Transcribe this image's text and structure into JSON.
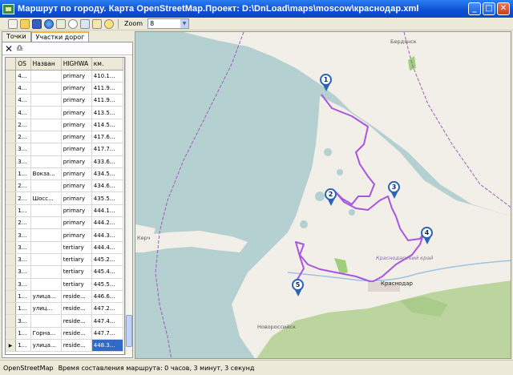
{
  "window": {
    "title": "Маршрут по городу. Карта OpenStreetMap.Проект: D:\\DnLoad\\maps\\moscow\\краснодар.xml",
    "minimize": "_",
    "maximize": "□",
    "close": "✕"
  },
  "toolbar": {
    "zoom_label": "Zoom",
    "zoom_value": "8",
    "icons": [
      "new-file-icon",
      "open-folder-icon",
      "save-icon",
      "globe-icon",
      "route-icon",
      "zoom-icon",
      "export-icon",
      "export-alt-icon",
      "help-icon"
    ]
  },
  "tabs": [
    {
      "label": "Точки",
      "active": false
    },
    {
      "label": "Участки дорог",
      "active": true
    }
  ],
  "grid": {
    "columns": [
      "OS",
      "Назван",
      "HIGHWA",
      "км."
    ],
    "rows": [
      {
        "os": "4...",
        "name": "",
        "hw": "primary",
        "km": "410.1..."
      },
      {
        "os": "4...",
        "name": "",
        "hw": "primary",
        "km": "411.9..."
      },
      {
        "os": "4...",
        "name": "",
        "hw": "primary",
        "km": "411.9..."
      },
      {
        "os": "4...",
        "name": "",
        "hw": "primary",
        "km": "413.5..."
      },
      {
        "os": "2...",
        "name": "",
        "hw": "primary",
        "km": "414.5..."
      },
      {
        "os": "2...",
        "name": "",
        "hw": "primary",
        "km": "417.6..."
      },
      {
        "os": "3...",
        "name": "",
        "hw": "primary",
        "km": "417.7..."
      },
      {
        "os": "3...",
        "name": "",
        "hw": "primary",
        "km": "433.6..."
      },
      {
        "os": "1...",
        "name": "Вокза...",
        "hw": "primary",
        "km": "434.5..."
      },
      {
        "os": "2...",
        "name": "",
        "hw": "primary",
        "km": "434.6..."
      },
      {
        "os": "2...",
        "name": "Шосс...",
        "hw": "primary",
        "km": "435.5..."
      },
      {
        "os": "1...",
        "name": "",
        "hw": "primary",
        "km": "444.1..."
      },
      {
        "os": "2...",
        "name": "",
        "hw": "primary",
        "km": "444.2..."
      },
      {
        "os": "3...",
        "name": "",
        "hw": "primary",
        "km": "444.3..."
      },
      {
        "os": "3...",
        "name": "",
        "hw": "tertiary",
        "km": "444.4..."
      },
      {
        "os": "3...",
        "name": "",
        "hw": "tertiary",
        "km": "445.2..."
      },
      {
        "os": "3...",
        "name": "",
        "hw": "tertiary",
        "km": "445.4..."
      },
      {
        "os": "3...",
        "name": "",
        "hw": "tertiary",
        "km": "445.5..."
      },
      {
        "os": "1...",
        "name": "улица...",
        "hw": "reside...",
        "km": "446.6..."
      },
      {
        "os": "1...",
        "name": "улиц...",
        "hw": "reside...",
        "km": "447.2..."
      },
      {
        "os": "3...",
        "name": "",
        "hw": "reside...",
        "km": "447.4..."
      },
      {
        "os": "1...",
        "name": "Горна...",
        "hw": "reside...",
        "km": "447.7..."
      },
      {
        "os": "1...",
        "name": "улица...",
        "hw": "reside...",
        "km": "448.3..."
      }
    ]
  },
  "map": {
    "labels": {
      "top": "Бердянск",
      "kerch": "Керч",
      "region": "Краснодарский край",
      "city": "Краснодар",
      "novoross": "Новороссийск"
    },
    "markers": [
      "1",
      "2",
      "3",
      "4",
      "5"
    ],
    "colors": {
      "sea": "#b5d0d0",
      "land": "#f2efe9",
      "forest": "#bcd59f",
      "route": "#a855e0",
      "border": "#9e5bb8"
    }
  },
  "status": {
    "source": "OpenStreetMap",
    "time": "Время составления маршрута: 0 часов, 3 минут, 3 секунд"
  }
}
